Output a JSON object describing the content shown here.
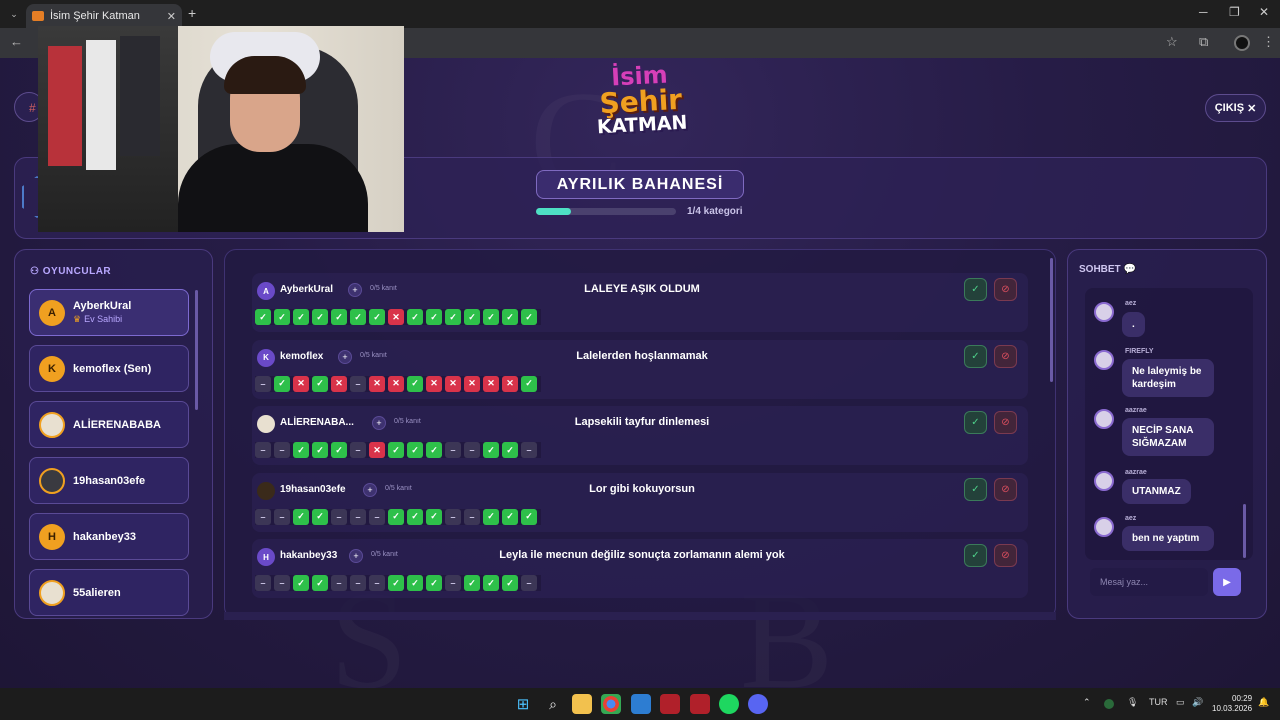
{
  "browser": {
    "tab_title": "İsim Şehir Katman",
    "new_tab": "+",
    "tab_close": "✕",
    "minimize": "─",
    "restore": "❐",
    "close": "✕"
  },
  "logo": {
    "line1": "İsim",
    "line2": "Şehir",
    "line3": "KATMAN"
  },
  "header": {
    "exit_label": "ÇIKIŞ",
    "exit_icon": "✕"
  },
  "category": {
    "title": "AYRILIK BAHANESİ",
    "progress_text": "1/4 kategori",
    "progress": 0.25
  },
  "players": {
    "title": "OYUNCULAR",
    "items": [
      {
        "initial": "A",
        "name": "AyberkUral",
        "role": "Ev Sahibi"
      },
      {
        "initial": "K",
        "name": "kemoflex (Sen)"
      },
      {
        "initial": "",
        "name": "ALİERENABABA"
      },
      {
        "initial": "",
        "name": "19hasan03efe"
      },
      {
        "initial": "H",
        "name": "hakanbey33"
      },
      {
        "initial": "",
        "name": "55alieren"
      }
    ]
  },
  "answers": {
    "plus": "+",
    "rows": [
      {
        "initial": "A",
        "name": "AyberkUral",
        "proof": "0/5 kanıt",
        "answer": "LALEYE AŞIK OLDUM",
        "votes": [
          "y",
          "y",
          "y",
          "y",
          "y",
          "y",
          "y",
          "n",
          "y",
          "y",
          "y",
          "y",
          "y",
          "y",
          "y"
        ]
      },
      {
        "initial": "K",
        "name": "kemoflex",
        "proof": "0/5 kanıt",
        "answer": "Lalelerden hoşlanmamak",
        "votes": [
          "d",
          "y",
          "n",
          "y",
          "n",
          "d",
          "n",
          "n",
          "y",
          "n",
          "n",
          "n",
          "n",
          "n",
          "y"
        ]
      },
      {
        "initial": "",
        "name": "ALİERENABA...",
        "proof": "0/5 kanıt",
        "answer": "Lapsekili tayfur dinlemesi",
        "votes": [
          "d",
          "d",
          "y",
          "y",
          "y",
          "d",
          "n",
          "y",
          "y",
          "y",
          "d",
          "d",
          "y",
          "y",
          "d"
        ]
      },
      {
        "initial": "",
        "name": "19hasan03efe",
        "proof": "0/5 kanıt",
        "answer": "Lor gibi kokuyorsun",
        "votes": [
          "d",
          "d",
          "y",
          "y",
          "d",
          "d",
          "d",
          "y",
          "y",
          "y",
          "d",
          "d",
          "y",
          "y",
          "y"
        ]
      },
      {
        "initial": "H",
        "name": "hakanbey33",
        "proof": "0/5 kanıt",
        "answer": "Leyla ile mecnun değiliz sonuçta zorlamanın alemi yok",
        "votes": [
          "d",
          "d",
          "y",
          "y",
          "d",
          "d",
          "d",
          "y",
          "y",
          "y",
          "d",
          "y",
          "y",
          "y",
          "d"
        ]
      }
    ]
  },
  "chat": {
    "title": "SOHBET",
    "input_placeholder": "Mesaj yaz...",
    "send_icon": "▶",
    "messages": [
      {
        "user": "aez",
        "text": "."
      },
      {
        "user": "FIREFLY",
        "text": "Ne laleymiş be kardeşim"
      },
      {
        "user": "aazrae",
        "text": "NECİP SANA SIĞMAZAM"
      },
      {
        "user": "aazrae",
        "text": "UTANMAZ"
      },
      {
        "user": "aez",
        "text": "ben ne yaptım"
      }
    ]
  },
  "taskbar": {
    "lang": "TUR",
    "time": "00:29",
    "date": "10.03.2026"
  },
  "colors": {
    "accent": "#7a6ae8",
    "yes": "#2ec04a",
    "no": "#d9334a",
    "progress": "#4ee0c4"
  },
  "icons": {
    "ok": "✓",
    "reject": "⊘",
    "yes": "✓",
    "no": "✕",
    "dash": "–",
    "crown": "♛",
    "chat": "💬"
  }
}
